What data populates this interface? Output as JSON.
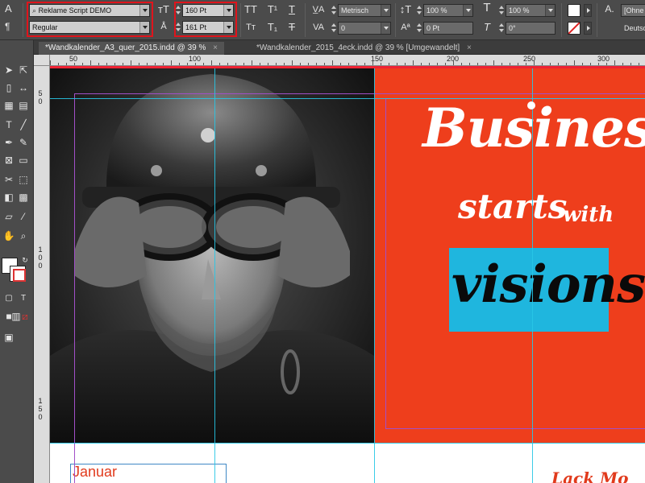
{
  "control_panel": {
    "font_family": "Reklame Script DEMO",
    "font_style": "Regular",
    "font_size": "160 Pt",
    "leading": "161 Pt",
    "kerning": "Metrisch",
    "tracking": "0",
    "vertical_scale": "100 %",
    "horizontal_scale": "100 %",
    "baseline_shift": "0 Pt",
    "skew": "0°",
    "language": "Deutsc",
    "char_style": "[Ohne",
    "char_style_prefix": "A.",
    "fill_color": "#ffffff"
  },
  "tabs": [
    {
      "label": "*Wandkalender_A3_quer_2015.indd @ 39 %",
      "active": true
    },
    {
      "label": "*Wandkalender_2015_4eck.indd @ 39 % [Umgewandelt]",
      "active": false
    }
  ],
  "ruler": {
    "top_labels": [
      "50",
      "100",
      "150",
      "200",
      "250",
      "300"
    ],
    "left_labels": [
      "5",
      "0",
      "1",
      "0",
      "0",
      "1",
      "5",
      "0"
    ]
  },
  "document": {
    "headline_1": "Business",
    "headline_2a": "starts",
    "headline_2b": "with",
    "headline_3": "visions",
    "month": "Januar",
    "bottom_text": "Lack Mo",
    "panel_color": "#ee3e1c",
    "box_color": "#1fb6de",
    "guide_color": "#27c7e6",
    "margin_color": "#a24fc8"
  },
  "tools": [
    "type-icon",
    "line-icon",
    "pen-icon",
    "pencil-icon",
    "rectangle-frame-icon",
    "rectangle-icon",
    "scissors-icon",
    "free-transform-icon",
    "gradient-swatch-icon",
    "gradient-feather-icon",
    "note-icon",
    "eyedropper-icon",
    "hand-icon",
    "zoom-icon"
  ],
  "highlight_color": "#e0141c"
}
